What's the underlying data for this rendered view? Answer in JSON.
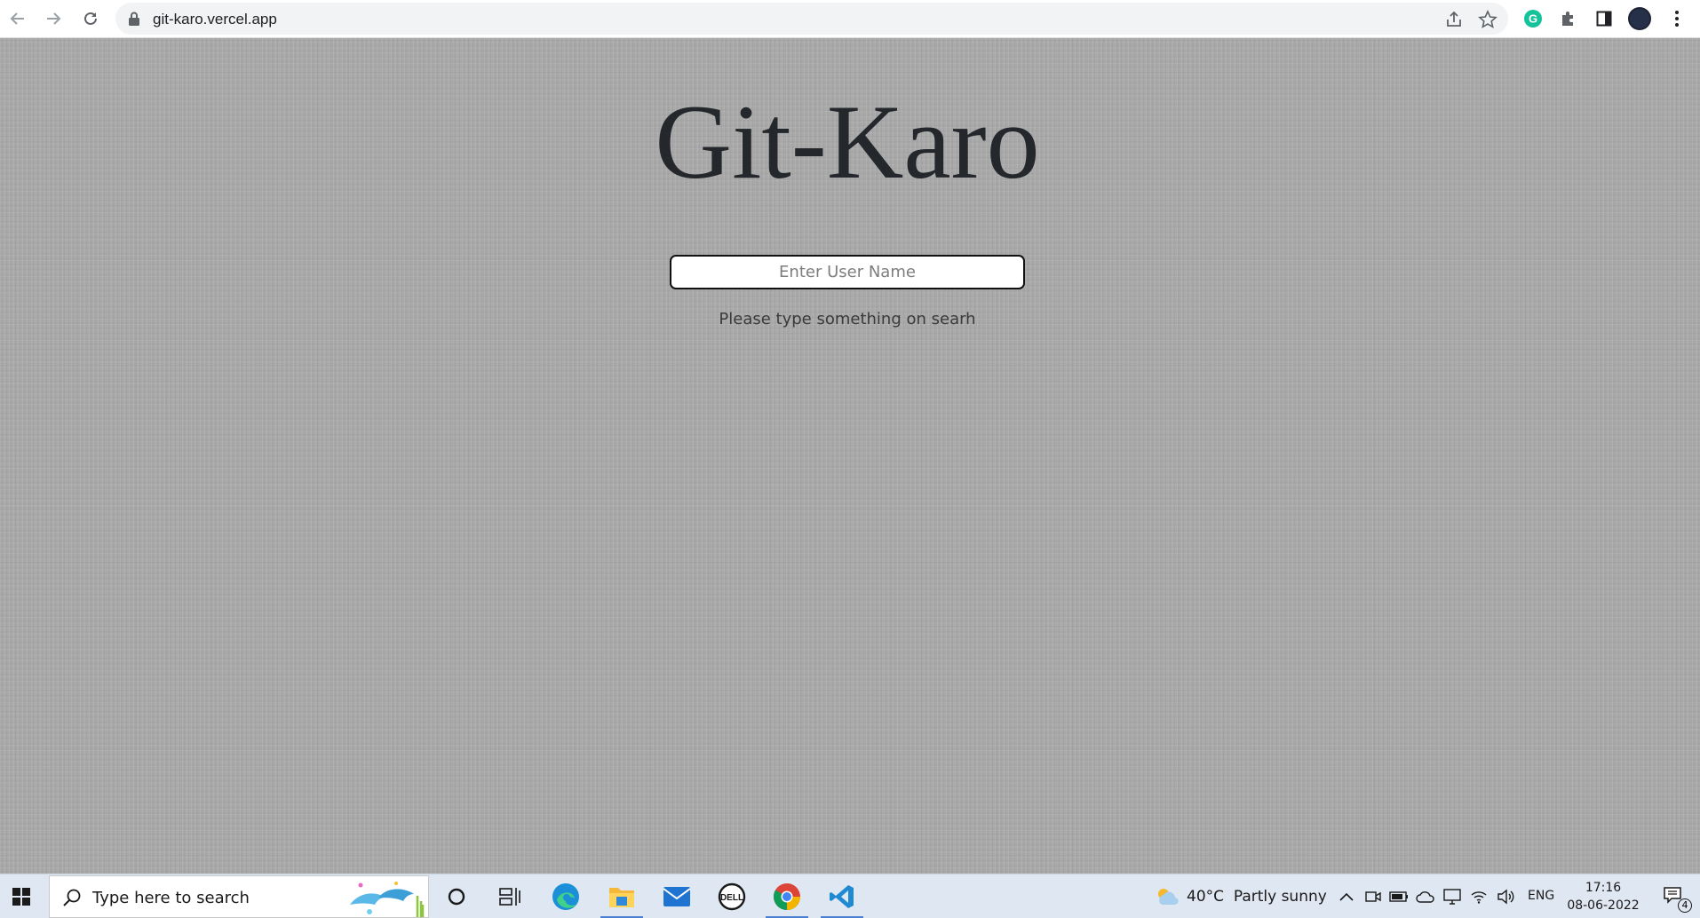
{
  "browser": {
    "url": "git-karo.vercel.app",
    "nav_icons": [
      "back-arrow-icon",
      "forward-arrow-icon",
      "reload-icon"
    ],
    "omnibox_icons": [
      "lock-icon",
      "share-icon",
      "bookmark-star-icon"
    ],
    "toolbar_icons": [
      "grammarly-extension-icon",
      "extensions-puzzle-icon",
      "side-panel-icon",
      "profile-avatar-icon",
      "chrome-menu-icon"
    ],
    "colors": {
      "toolbar_bg": "#ffffff",
      "omnibox_bg": "#f1f3f4",
      "grammarly": "#15c39a",
      "avatar": "#1e2433"
    }
  },
  "page": {
    "title": "Git-Karo",
    "search_placeholder": "Enter User Name",
    "search_value": "",
    "hint": "Please type something on searh",
    "colors": {
      "background": "#a9a9a9",
      "title": "#24272b",
      "input_border": "#111111"
    }
  },
  "taskbar": {
    "search_placeholder": "Type here to search",
    "pinned_apps": [
      "cortana-circle-icon",
      "task-view-icon",
      "edge-browser-icon",
      "file-explorer-icon",
      "mail-icon",
      "dell-icon",
      "chrome-browser-icon",
      "vscode-icon"
    ],
    "weather": {
      "temp": "40°C",
      "condition": "Partly sunny"
    },
    "tray_icons": [
      "show-hidden-icons-chevron",
      "meet-now-icon",
      "battery-icon",
      "onedrive-cloud-icon",
      "display-icon",
      "wifi-icon",
      "volume-icon"
    ],
    "language": "ENG",
    "time": "17:16",
    "date": "08-06-2022",
    "notification_count": "4",
    "colors": {
      "background": "#dfe7f2",
      "windows_blue": "#1f6fd1",
      "active_indicator": "#4a7fd1"
    }
  }
}
